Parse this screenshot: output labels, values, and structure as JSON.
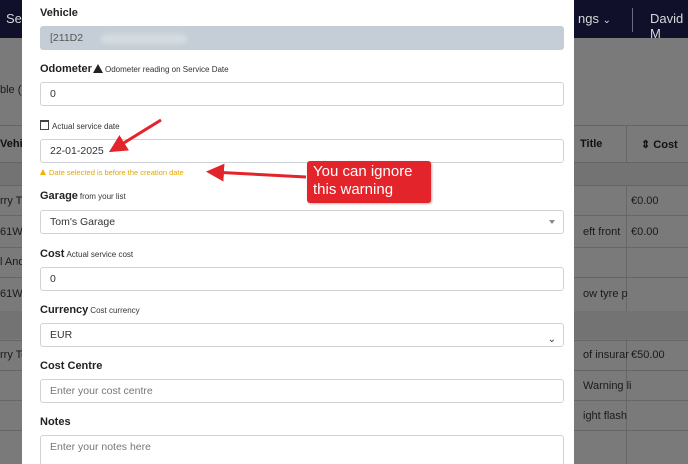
{
  "background": {
    "nav_left": "Ser",
    "nav_right_menu": "ngs",
    "nav_user": "David M",
    "subtitle_fragment": "ble (.",
    "header_col1": "Vehicl",
    "header_title": "Title",
    "header_cost": "Cost",
    "rows": [
      {
        "c1": "rry T",
        "title": "",
        "cost": "€0.00"
      },
      {
        "c1": "61W",
        "title": "eft front",
        "cost": "€0.00"
      },
      {
        "c1": "l And",
        "title": "",
        "cost": ""
      },
      {
        "c1": "61W",
        "title": "ow tyre p",
        "cost": ""
      },
      {
        "c1": "rry Te",
        "title": "of insurar",
        "cost": "€50.00"
      },
      {
        "c1": "",
        "title": "Warning li",
        "cost": ""
      },
      {
        "c1": "",
        "title": "ight flash",
        "cost": ""
      }
    ]
  },
  "form": {
    "vehicle": {
      "label": "Vehicle",
      "value": "[211D2"
    },
    "odometer": {
      "label": "Odometer",
      "hint": "Odometer reading on Service Date",
      "value": "0"
    },
    "service_date": {
      "hint": "Actual service date",
      "value": "22-01-2025",
      "warning": "Date selected is before the creation date"
    },
    "garage": {
      "label": "Garage",
      "hint": "from your list",
      "value": "Tom's Garage"
    },
    "cost": {
      "label": "Cost",
      "hint": "Actual service cost",
      "value": "0"
    },
    "currency": {
      "label": "Currency",
      "hint": "Cost currency",
      "value": "EUR"
    },
    "cost_centre": {
      "label": "Cost Centre",
      "placeholder": "Enter your cost centre"
    },
    "notes": {
      "label": "Notes",
      "placeholder": "Enter your notes here"
    }
  },
  "annotation": {
    "callout_text": "You can ignore this warning",
    "color": "#e3242b"
  }
}
